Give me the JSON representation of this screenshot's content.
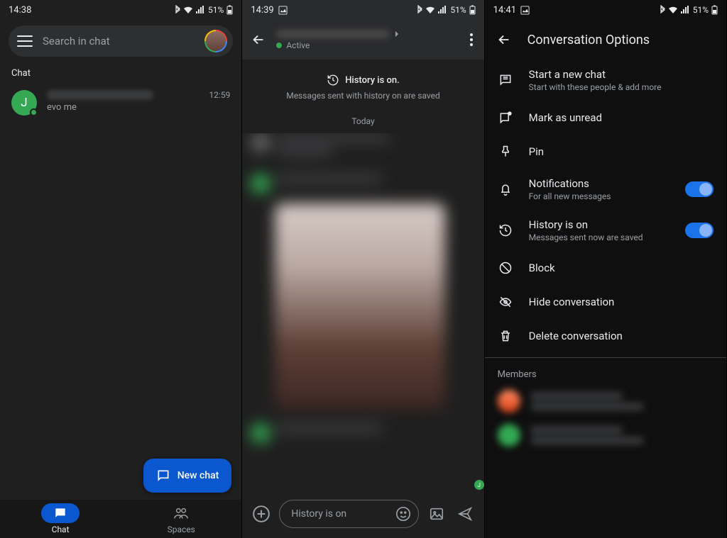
{
  "pane1": {
    "status": {
      "time": "14:38",
      "battery": "51%"
    },
    "search_placeholder": "Search in chat",
    "section_label": "Chat",
    "chat_item": {
      "avatar_letter": "J",
      "preview": "evo me",
      "time": "12:59"
    },
    "fab_label": "New chat",
    "nav": {
      "chat": "Chat",
      "spaces": "Spaces"
    }
  },
  "pane2": {
    "status": {
      "time": "14:39",
      "battery": "51%"
    },
    "active_label": "Active",
    "history_title": "History is on.",
    "history_sub": "Messages sent with history on are saved",
    "date_label": "Today",
    "compose_placeholder": "History is on",
    "read_receipt": "J"
  },
  "pane3": {
    "status": {
      "time": "14:41",
      "battery": "51%"
    },
    "header": "Conversation Options",
    "options": {
      "new_chat": {
        "title": "Start a new chat",
        "sub": "Start with these people & add more"
      },
      "unread": {
        "title": "Mark as unread"
      },
      "pin": {
        "title": "Pin"
      },
      "notifications": {
        "title": "Notifications",
        "sub": "For all new messages"
      },
      "history": {
        "title": "History is on",
        "sub": "Messages sent now are saved"
      },
      "block": {
        "title": "Block"
      },
      "hide": {
        "title": "Hide conversation"
      },
      "delete": {
        "title": "Delete conversation"
      }
    },
    "members_label": "Members"
  }
}
